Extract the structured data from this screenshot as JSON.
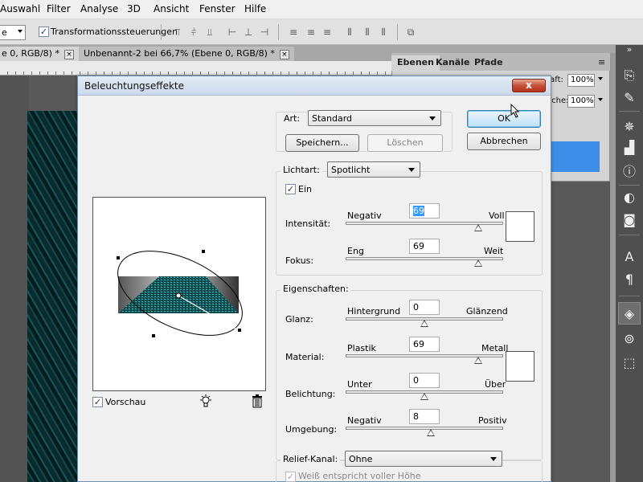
{
  "menu": [
    "Auswahl",
    "Filter",
    "Analyse",
    "3D",
    "Ansicht",
    "Fenster",
    "Hilfe"
  ],
  "options_bar": {
    "combo_value": "e",
    "transform_label": "Transformationssteuerungen",
    "transform_checked": true
  },
  "doc_tabs": [
    {
      "label": "e 0, RGB/8) *",
      "close": "×"
    },
    {
      "label": "Unbenannt-2 bei 66,7% (Ebene 0, RGB/8) *",
      "close": "×"
    }
  ],
  "panel": {
    "tabs": [
      "Ebenen",
      "Kanäle",
      "Pfade"
    ],
    "deckkraft_label": "raft:",
    "deckkraft_value": "100%",
    "flaeche_label": "äche:",
    "flaeche_value": "100%",
    "close_glyph": "×",
    "menu_glyph": "≡",
    "dock_glyph": "»"
  },
  "dialog": {
    "title": "Beleuchtungseffekte",
    "close_glyph": "x",
    "art_label": "Art:",
    "art_value": "Standard",
    "save_button": "Speichern...",
    "delete_button": "Löschen",
    "ok_button": "OK",
    "cancel_button": "Abbrechen",
    "lichtart_label": "Lichtart:",
    "lichtart_value": "Spotlicht",
    "ein_label": "Ein",
    "ein_checked": true,
    "preview_label": "Vorschau",
    "preview_checked": true,
    "sliders_light": [
      {
        "label": "Intensität:",
        "left": "Negativ",
        "right": "Voll",
        "value": "69",
        "selected": true,
        "position": 0.84
      },
      {
        "label": "Fokus:",
        "left": "Eng",
        "right": "Weit",
        "value": "69",
        "selected": false,
        "position": 0.84
      }
    ],
    "properties_label": "Eigenschaften:",
    "sliders_props": [
      {
        "label": "Glanz:",
        "left": "Hintergrund",
        "right": "Glänzend",
        "value": "0",
        "position": 0.5
      },
      {
        "label": "Material:",
        "left": "Plastik",
        "right": "Metall",
        "value": "69",
        "position": 0.84
      },
      {
        "label": "Belichtung:",
        "left": "Unter",
        "right": "Über",
        "value": "0",
        "position": 0.5
      },
      {
        "label": "Umgebung:",
        "left": "Negativ",
        "right": "Positiv",
        "value": "8",
        "position": 0.54
      }
    ],
    "relief_label": "Relief-Kanal:",
    "relief_value": "Ohne",
    "white_high_label": "Weiß entspricht voller Höhe",
    "white_high_checked": true
  },
  "colors": {
    "selection_blue": "#3399ff",
    "panel_selected": "#3c8ee8",
    "canvas_teal": "#0f4a4e"
  },
  "icons": {
    "checkmark": "✓",
    "lightbulb": "light-bulb-icon",
    "trash": "trash-icon"
  }
}
